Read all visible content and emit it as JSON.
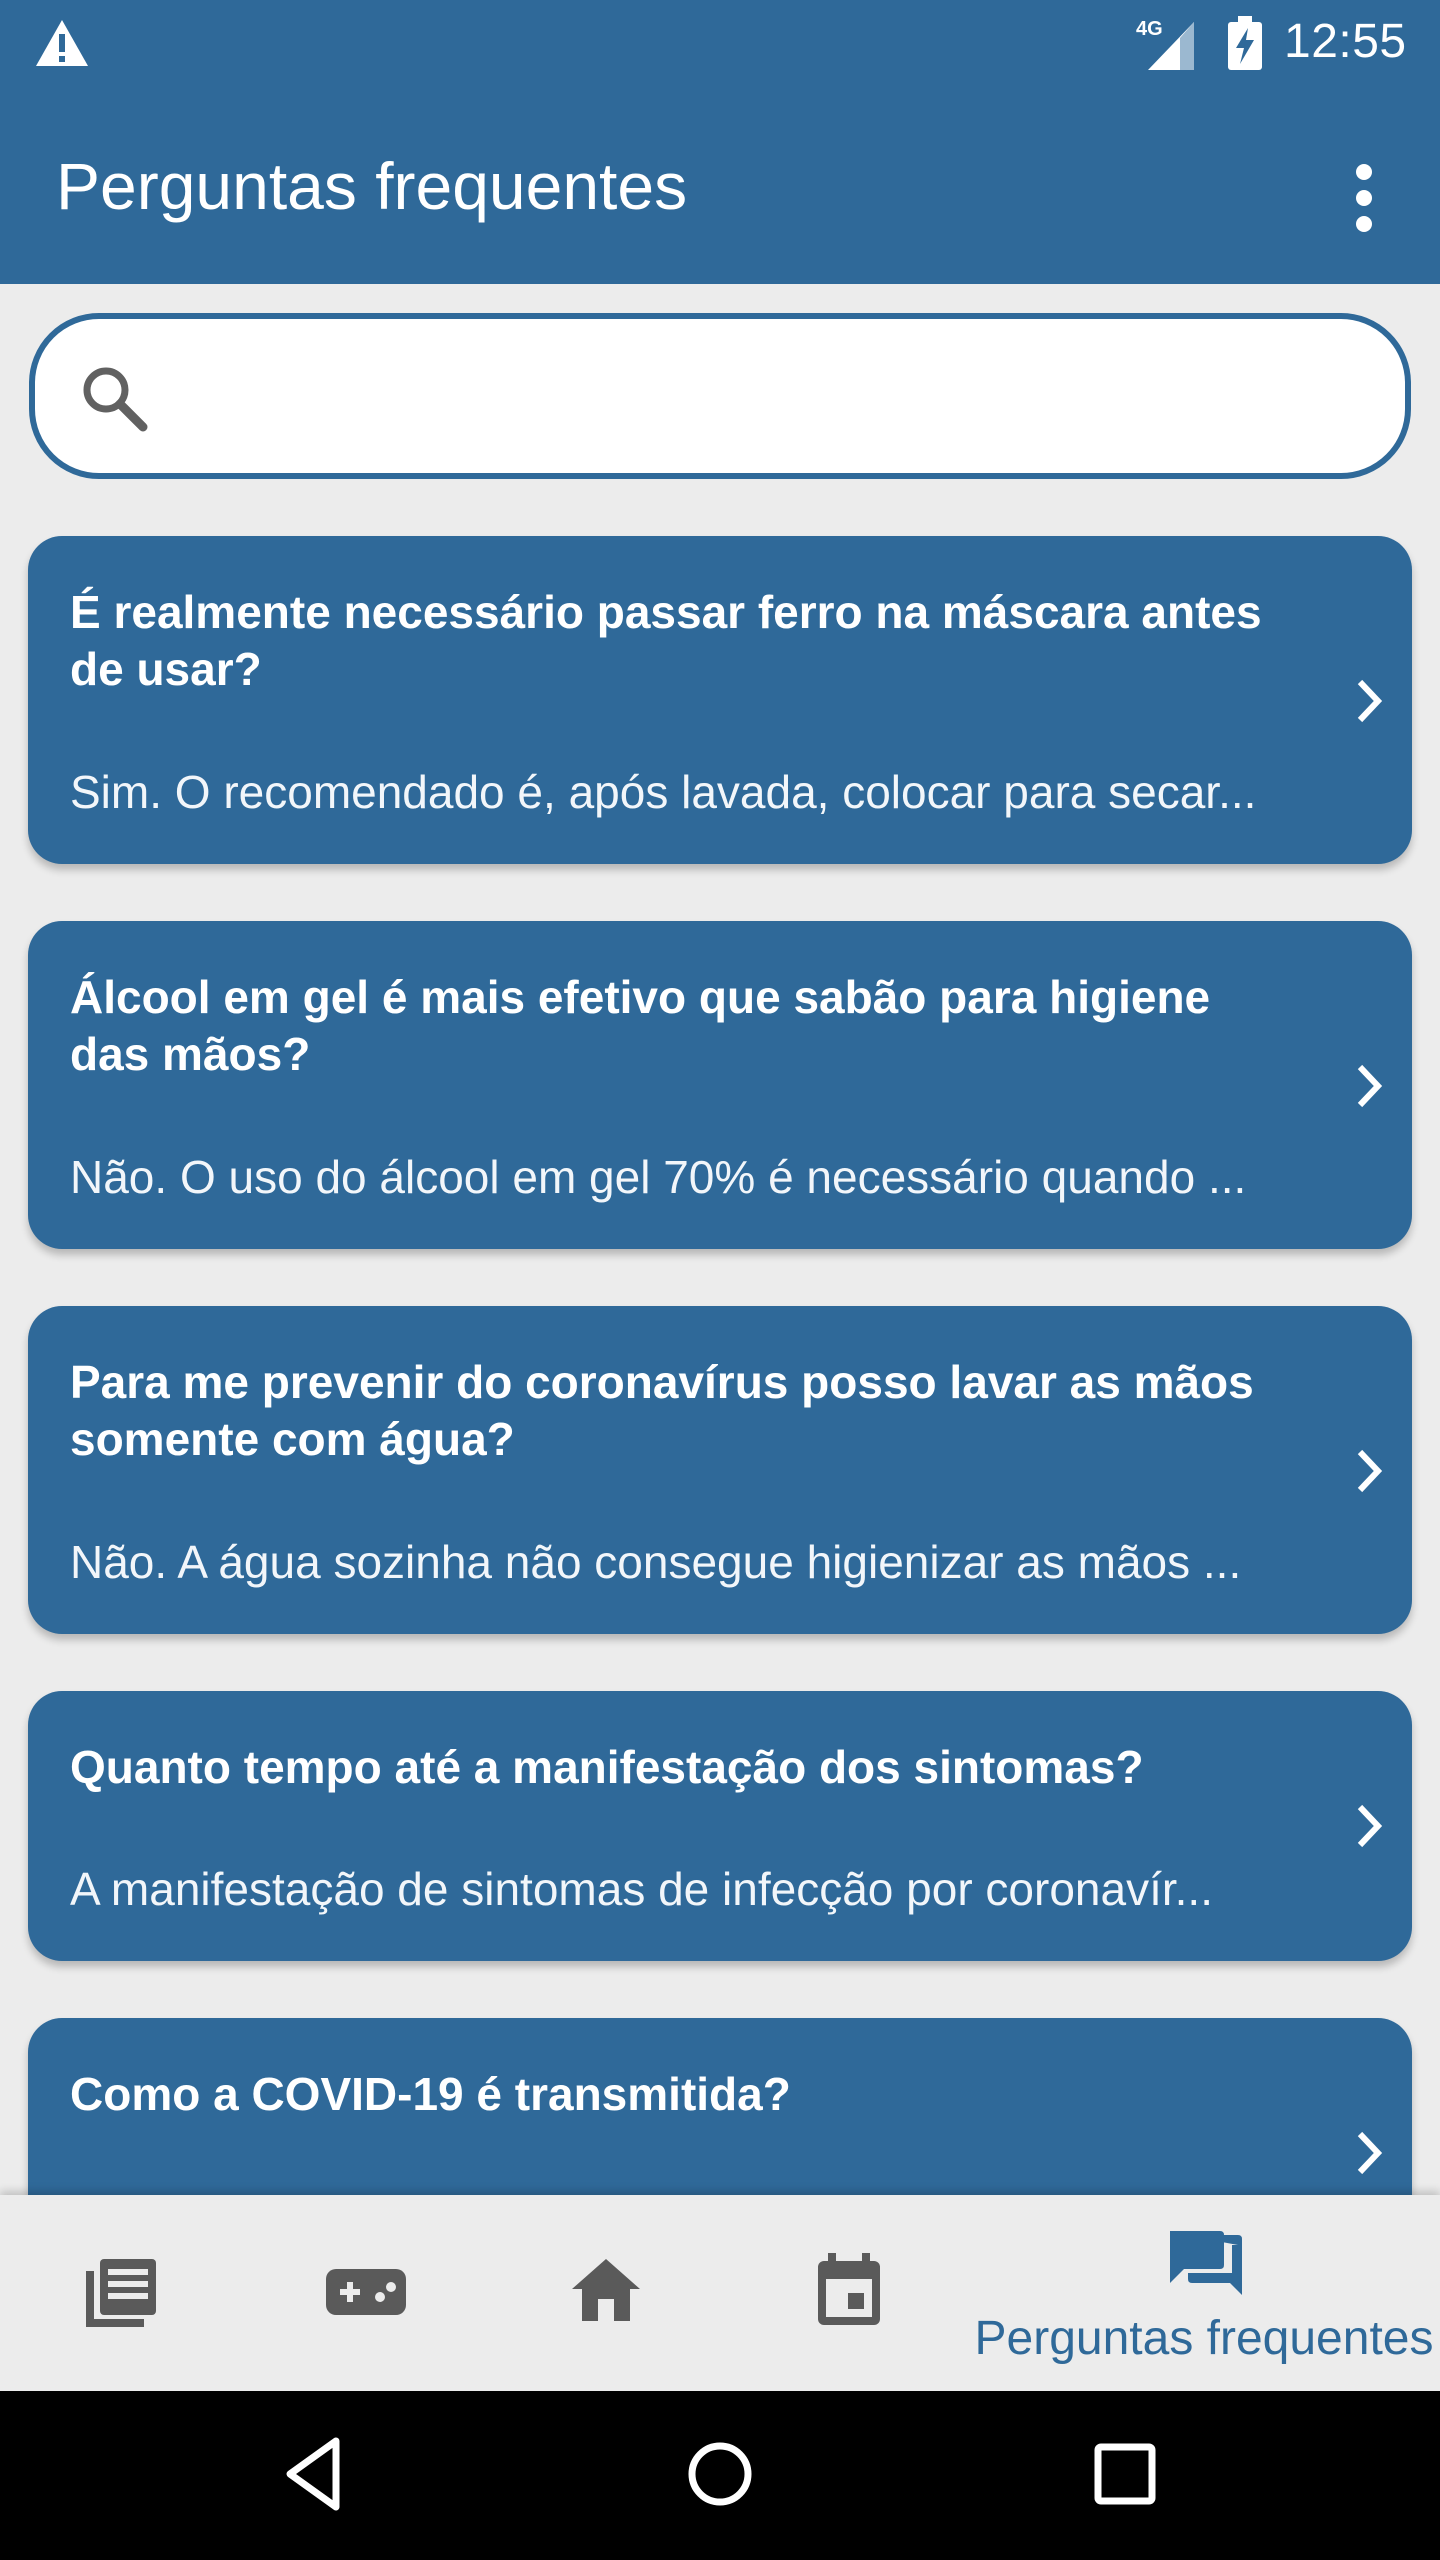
{
  "status_bar": {
    "warning_icon": "warning-icon",
    "network_label": "4G",
    "time": "12:55"
  },
  "app_bar": {
    "title": "Perguntas frequentes",
    "menu_icon": "more-vert-icon"
  },
  "search": {
    "placeholder": "",
    "value": "",
    "icon": "search-icon"
  },
  "faq": [
    {
      "question": "É realmente necessário passar ferro na máscara antes de usar?",
      "answer": "Sim. O recomendado é, após lavada, colocar para secar..."
    },
    {
      "question": "Álcool em gel é mais efetivo que sabão para higiene das mãos?",
      "answer": "Não. O uso do álcool em gel 70% é necessário quando ..."
    },
    {
      "question": "Para me prevenir do coronavírus posso lavar as mãos somente com água?",
      "answer": "Não. A água sozinha não consegue higienizar as mãos ..."
    },
    {
      "question": "Quanto tempo até a manifestação dos sintomas?",
      "answer": "A manifestação de sintomas de infecção por coronavír..."
    },
    {
      "question": "Como a COVID-19 é transmitida?",
      "answer": ""
    }
  ],
  "bottom_nav": {
    "items": [
      {
        "icon": "news-icon"
      },
      {
        "icon": "gamepad-icon"
      },
      {
        "icon": "home-icon"
      },
      {
        "icon": "calendar-icon"
      },
      {
        "icon": "forum-icon",
        "label": "Perguntas frequentes"
      }
    ],
    "active_color": "#2f6999",
    "inactive_color": "#5a5a5a"
  },
  "colors": {
    "primary": "#2f6999",
    "background": "#ececec"
  }
}
